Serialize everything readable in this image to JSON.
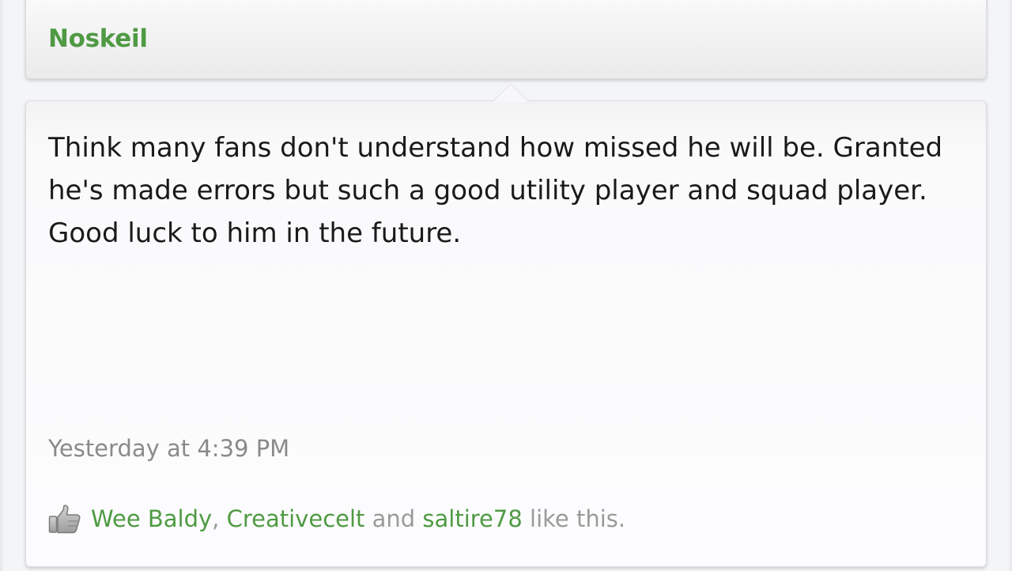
{
  "post": {
    "author": "Noskeil",
    "message": "Think many fans don't understand how missed he will be. Granted he's made errors but such a good utility player and squad player. Good luck to him in the future.",
    "timestamp": "Yesterday at 4:39 PM",
    "likes": {
      "icon": "thumbs-up-icon",
      "likers": [
        "Wee Baldy",
        "Creativecelt",
        "saltire78"
      ],
      "separator_comma": ", ",
      "separator_and": " and ",
      "suffix": " like this."
    }
  },
  "colors": {
    "link_green": "#4f9a43",
    "muted_text": "#8a8a8a",
    "body_text": "#1a1a1a"
  }
}
